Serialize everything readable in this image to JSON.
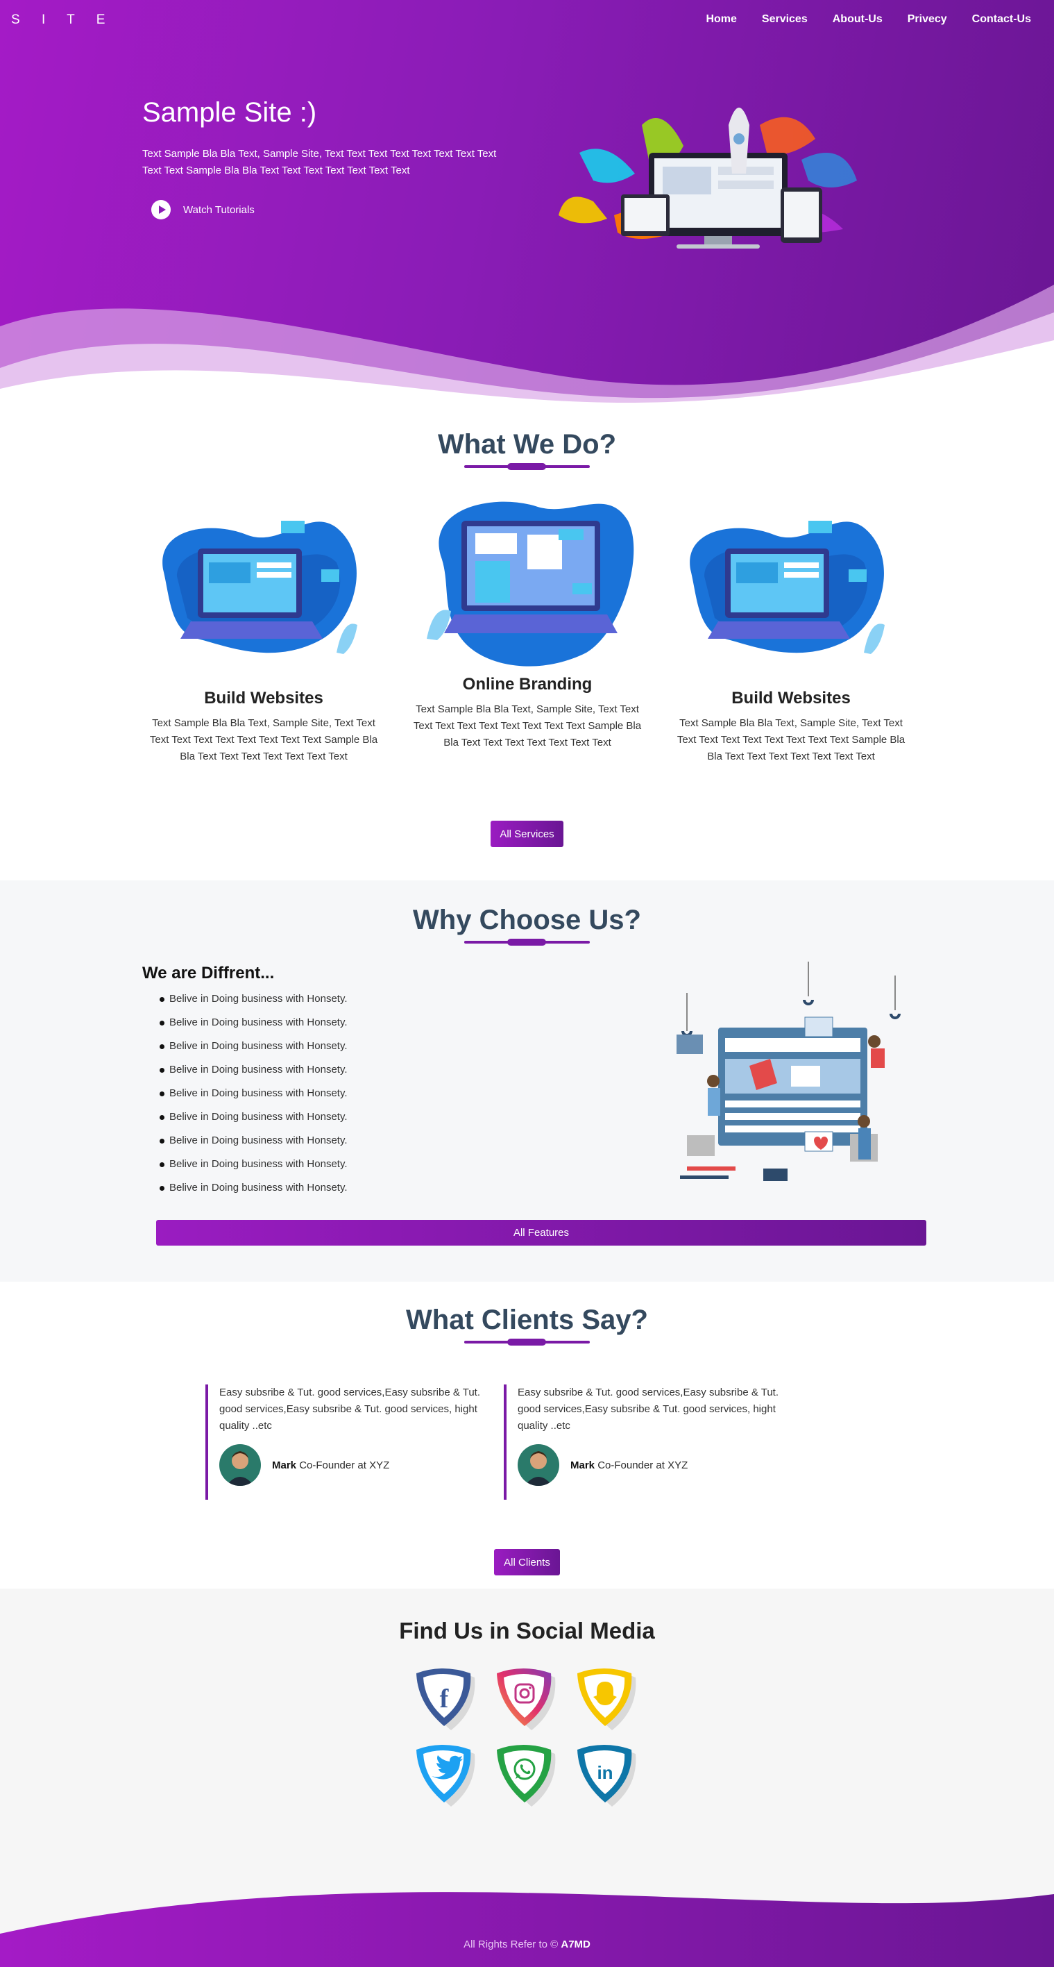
{
  "header": {
    "logo": "S I T E",
    "nav": [
      "Home",
      "Services",
      "About-Us",
      "Privecy",
      "Contact-Us"
    ]
  },
  "hero": {
    "title": "Sample Site :)",
    "text": "Text Sample Bla Bla Text, Sample Site, Text Text Text Text Text Text Text Text Text Text Sample Bla Bla Text Text Text Text Text Text Text",
    "watch_label": "Watch Tutorials"
  },
  "services": {
    "title": "What We Do?",
    "items": [
      {
        "title": "Build Websites",
        "text": "Text Sample Bla Bla Text, Sample Site, Text Text Text Text Text Text Text Text Text Text Sample Bla Bla Text Text Text Text Text Text Text"
      },
      {
        "title": "Online Branding",
        "text": "Text Sample Bla Bla Text, Sample Site, Text Text Text Text Text Text Text Text Text Text Sample Bla Bla Text Text Text Text Text Text Text"
      },
      {
        "title": "Build Websites",
        "text": "Text Sample Bla Bla Text, Sample Site, Text Text Text Text Text Text Text Text Text Text Sample Bla Bla Text Text Text Text Text Text Text"
      }
    ],
    "button": "All Services"
  },
  "why": {
    "title": "Why Choose Us?",
    "subtitle": "We are Diffrent...",
    "items": [
      "Belive in Doing business with Honsety.",
      "Belive in Doing business with Honsety.",
      "Belive in Doing business with Honsety.",
      "Belive in Doing business with Honsety.",
      "Belive in Doing business with Honsety.",
      "Belive in Doing business with Honsety.",
      "Belive in Doing business with Honsety.",
      "Belive in Doing business with Honsety.",
      "Belive in Doing business with Honsety."
    ],
    "button": "All Features"
  },
  "clients": {
    "title": "What Clients Say?",
    "items": [
      {
        "quote": "Easy subsribe & Tut. good services,Easy subsribe & Tut. good services,Easy subsribe & Tut. good services, hight quality ..etc",
        "name": "Mark",
        "role": " Co-Founder at XYZ"
      },
      {
        "quote": "Easy subsribe & Tut. good services,Easy subsribe & Tut. good services,Easy subsribe & Tut. good services, hight quality ..etc",
        "name": "Mark",
        "role": " Co-Founder at XYZ"
      }
    ],
    "button": "All Clients"
  },
  "social": {
    "title": "Find Us in Social Media",
    "items": [
      {
        "icon": "facebook-icon",
        "color": "#3b5998"
      },
      {
        "icon": "instagram-icon",
        "color": "#c13584"
      },
      {
        "icon": "snapchat-icon",
        "color": "#f7c600"
      },
      {
        "icon": "twitter-icon",
        "color": "#1da1f2"
      },
      {
        "icon": "whatsapp-icon",
        "color": "#25a244"
      },
      {
        "icon": "linkedin-icon",
        "color": "#0e76a8"
      }
    ]
  },
  "footer": {
    "prefix": "All Rights Refer to © ",
    "brand": "A7MD"
  },
  "colors": {
    "brand_purple": "#8a1cb6",
    "heading": "#34495e"
  }
}
